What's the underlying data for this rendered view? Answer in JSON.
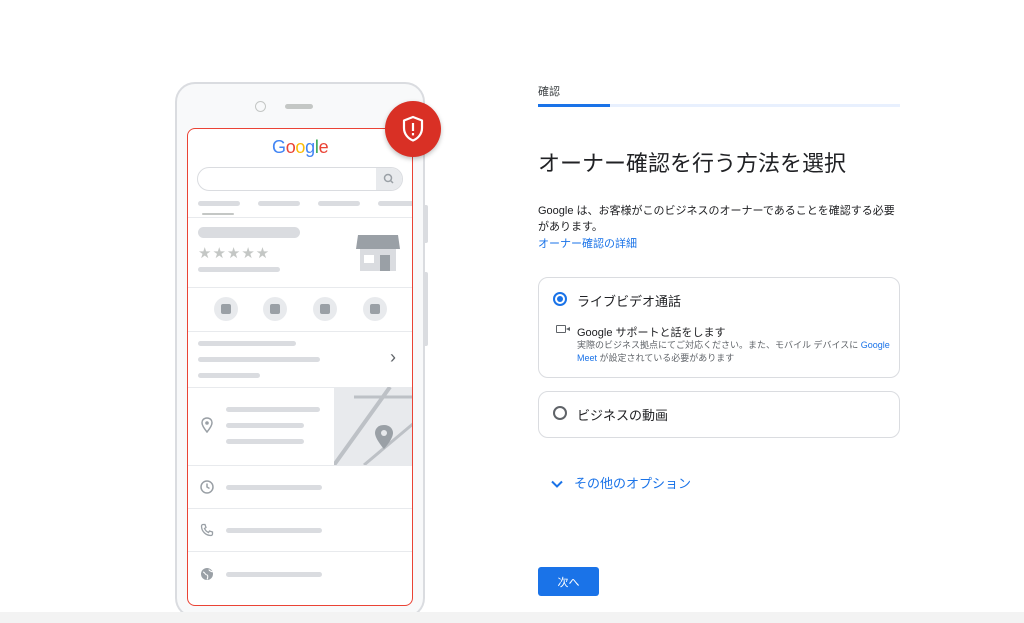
{
  "illustration": {
    "logo_letters": [
      {
        "char": "G",
        "color": "#4285F4"
      },
      {
        "char": "o",
        "color": "#EA4335"
      },
      {
        "char": "o",
        "color": "#FBBC05"
      },
      {
        "char": "g",
        "color": "#4285F4"
      },
      {
        "char": "l",
        "color": "#34A853"
      },
      {
        "char": "e",
        "color": "#EA4335"
      }
    ],
    "rating_stars": "★★★★★",
    "chevron": "›",
    "badge_icon": "shield-alert-icon",
    "badge_color": "#D93025"
  },
  "header": {
    "step_label": "確認",
    "progress": 0.2
  },
  "main": {
    "title": "オーナー確認を行う方法を選択",
    "description": "Google は、お客様がこのビジネスのオーナーであることを確認する必要があります。",
    "details_link": "オーナー確認の詳細",
    "options": [
      {
        "label": "ライブビデオ通話",
        "selected": true,
        "sub_title": "Google サポートと話をします",
        "sub_note_before": "実際のビジネス拠点にてご対応ください。また、モバイル デバイスに ",
        "sub_note_link": "Google Meet",
        "sub_note_after": " が設定されている必要があります"
      },
      {
        "label": "ビジネスの動画",
        "selected": false
      }
    ],
    "more_options": "その他のオプション",
    "next_button": "次へ"
  },
  "colors": {
    "accent": "#1A73E8",
    "alert": "#D93025"
  }
}
